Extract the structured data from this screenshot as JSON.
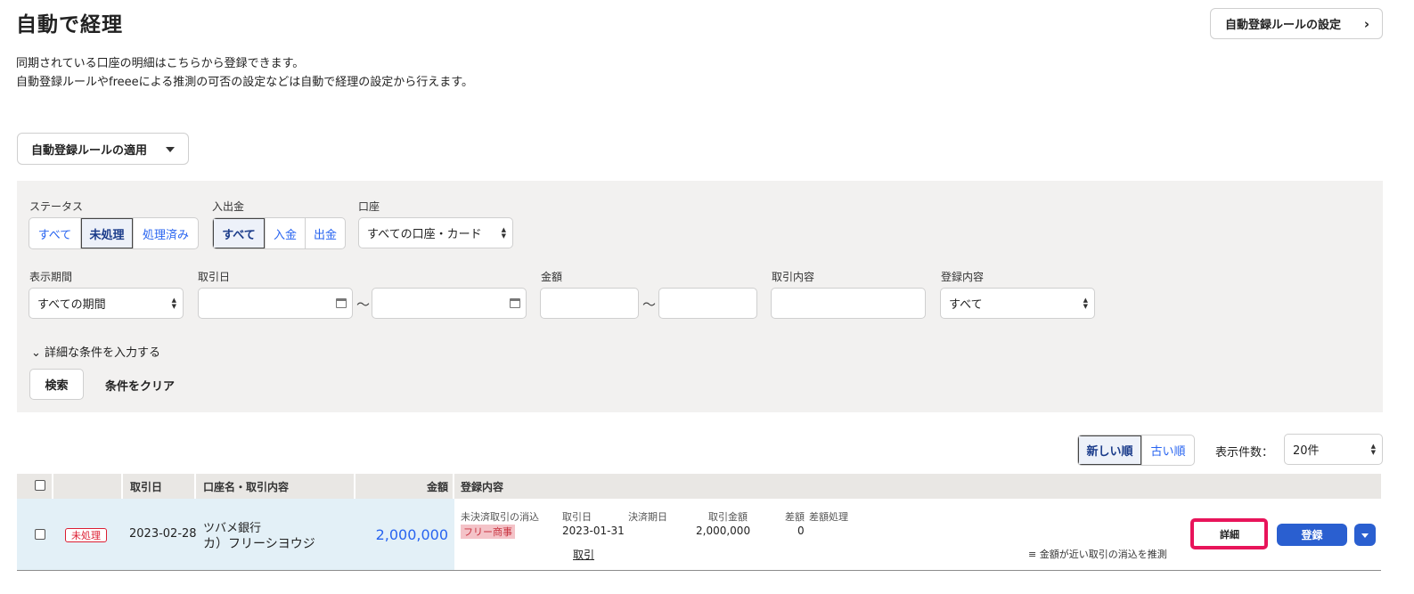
{
  "page": {
    "title": "自動で経理",
    "settings_button": "自動登録ルールの設定",
    "desc_line1": "同期されている口座の明細はこちらから登録できます。",
    "desc_line2": "自動登録ルールやfreeeによる推測の可否の設定などは自動で経理の設定から行えます。",
    "apply_rules_button": "自動登録ルールの適用"
  },
  "filters": {
    "status": {
      "label": "ステータス",
      "options": [
        "すべて",
        "未処理",
        "処理済み"
      ],
      "selected": "未処理"
    },
    "inout": {
      "label": "入出金",
      "options": [
        "すべて",
        "入金",
        "出金"
      ],
      "selected": "すべて"
    },
    "account": {
      "label": "口座",
      "value": "すべての口座・カード"
    },
    "period": {
      "label": "表示期間",
      "value": "すべての期間"
    },
    "trade_date": {
      "label": "取引日"
    },
    "amount": {
      "label": "金額"
    },
    "content": {
      "label": "取引内容"
    },
    "registered": {
      "label": "登録内容",
      "value": "すべて"
    },
    "tilde": "〜",
    "expand": "詳細な条件を入力する",
    "search_button": "検索",
    "clear_button": "条件をクリア"
  },
  "list_controls": {
    "sort_options": [
      "新しい順",
      "古い順"
    ],
    "sort_selected": "新しい順",
    "count_label": "表示件数：",
    "count_value": "20件"
  },
  "table": {
    "headers": {
      "date": "取引日",
      "account": "口座名・取引内容",
      "amount": "金額",
      "registered": "登録内容"
    },
    "rows": [
      {
        "status": "未処理",
        "date": "2023-02-28",
        "bank": "ツバメ銀行",
        "desc": "カ）フリーシヨウジ",
        "amount": "2,000,000",
        "match_type": "未決済取引の消込",
        "partner": "フリー商事",
        "h_date": "取引日",
        "h_due": "決済期日",
        "h_amount": "取引金額",
        "h_diff": "差額",
        "h_diffproc": "差額処理",
        "match_date": "2023-01-31",
        "match_amount": "2,000,000",
        "diff": "0",
        "trade_link": "取引",
        "guess_note": "金額が近い取引の消込を推測",
        "detail_button": "詳細",
        "register_button": "登録"
      }
    ]
  }
}
